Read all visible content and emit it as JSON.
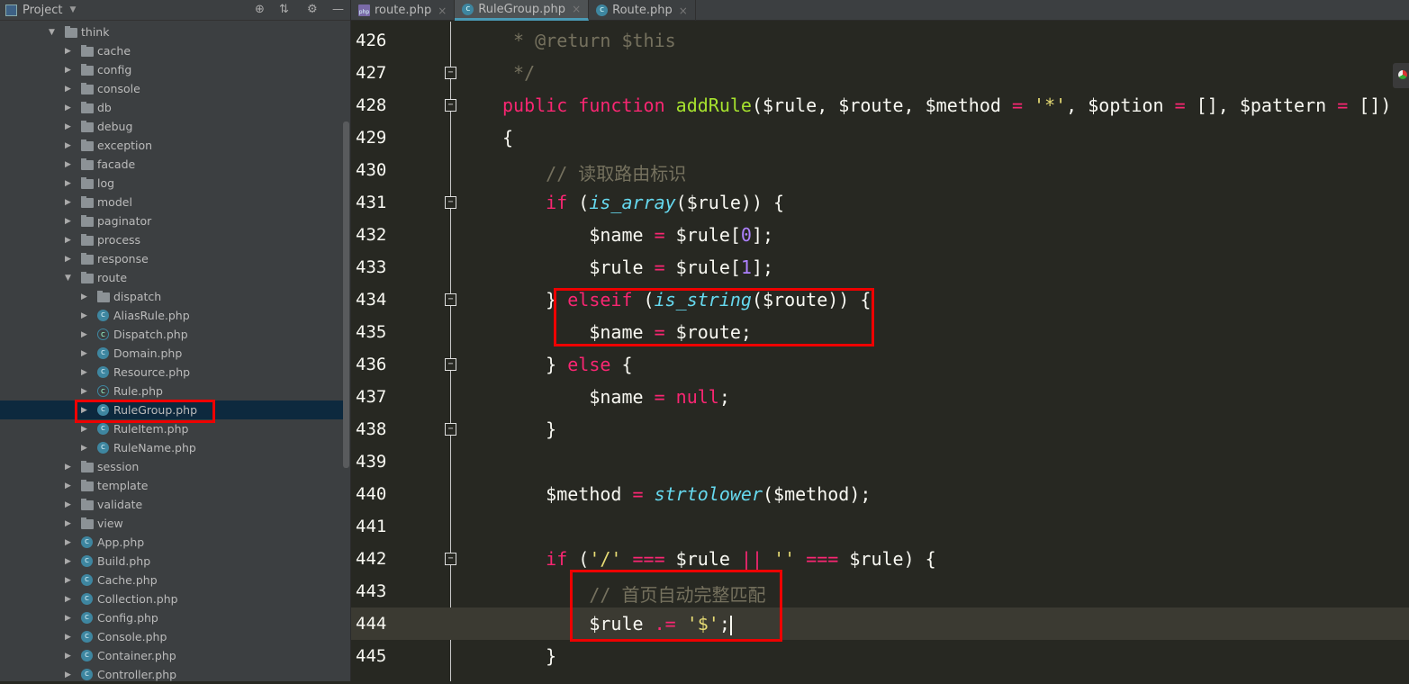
{
  "sidebar": {
    "title": "Project",
    "tree": [
      {
        "label": "think",
        "depth": 0,
        "type": "folder",
        "open": true
      },
      {
        "label": "cache",
        "depth": 1,
        "type": "folder"
      },
      {
        "label": "config",
        "depth": 1,
        "type": "folder"
      },
      {
        "label": "console",
        "depth": 1,
        "type": "folder"
      },
      {
        "label": "db",
        "depth": 1,
        "type": "folder"
      },
      {
        "label": "debug",
        "depth": 1,
        "type": "folder"
      },
      {
        "label": "exception",
        "depth": 1,
        "type": "folder"
      },
      {
        "label": "facade",
        "depth": 1,
        "type": "folder"
      },
      {
        "label": "log",
        "depth": 1,
        "type": "folder"
      },
      {
        "label": "model",
        "depth": 1,
        "type": "folder"
      },
      {
        "label": "paginator",
        "depth": 1,
        "type": "folder"
      },
      {
        "label": "process",
        "depth": 1,
        "type": "folder"
      },
      {
        "label": "response",
        "depth": 1,
        "type": "folder"
      },
      {
        "label": "route",
        "depth": 1,
        "type": "folder",
        "open": true
      },
      {
        "label": "dispatch",
        "depth": 2,
        "type": "folder"
      },
      {
        "label": "AliasRule.php",
        "depth": 2,
        "type": "class"
      },
      {
        "label": "Dispatch.php",
        "depth": 2,
        "type": "abstract"
      },
      {
        "label": "Domain.php",
        "depth": 2,
        "type": "class"
      },
      {
        "label": "Resource.php",
        "depth": 2,
        "type": "class"
      },
      {
        "label": "Rule.php",
        "depth": 2,
        "type": "abstract"
      },
      {
        "label": "RuleGroup.php",
        "depth": 2,
        "type": "class",
        "selected": true
      },
      {
        "label": "RuleItem.php",
        "depth": 2,
        "type": "class"
      },
      {
        "label": "RuleName.php",
        "depth": 2,
        "type": "class"
      },
      {
        "label": "session",
        "depth": 1,
        "type": "folder"
      },
      {
        "label": "template",
        "depth": 1,
        "type": "folder"
      },
      {
        "label": "validate",
        "depth": 1,
        "type": "folder"
      },
      {
        "label": "view",
        "depth": 1,
        "type": "folder"
      },
      {
        "label": "App.php",
        "depth": 1,
        "type": "class"
      },
      {
        "label": "Build.php",
        "depth": 1,
        "type": "class"
      },
      {
        "label": "Cache.php",
        "depth": 1,
        "type": "class"
      },
      {
        "label": "Collection.php",
        "depth": 1,
        "type": "class"
      },
      {
        "label": "Config.php",
        "depth": 1,
        "type": "class"
      },
      {
        "label": "Console.php",
        "depth": 1,
        "type": "class"
      },
      {
        "label": "Container.php",
        "depth": 1,
        "type": "class"
      },
      {
        "label": "Controller.php",
        "depth": 1,
        "type": "class"
      }
    ]
  },
  "tabs": [
    {
      "label": "route.php",
      "icon": "php-file-icon"
    },
    {
      "label": "RuleGroup.php",
      "icon": "class-icon",
      "active": true
    },
    {
      "label": "Route.php",
      "icon": "class-icon"
    }
  ],
  "editor": {
    "current_line": 444,
    "lines": [
      {
        "num": "426",
        "tokens": [
          [
            "c",
            " * @return $this"
          ]
        ]
      },
      {
        "num": "427",
        "tokens": [
          [
            "c",
            " */"
          ]
        ]
      },
      {
        "num": "428",
        "tokens": [
          [
            "k",
            "public function "
          ],
          [
            "f",
            "addRule"
          ],
          [
            "v",
            "($rule, $route, $method "
          ],
          [
            "k",
            "="
          ],
          [
            "v",
            " "
          ],
          [
            "s",
            "'*'"
          ],
          [
            "v",
            ", $option "
          ],
          [
            "k",
            "="
          ],
          [
            "v",
            " [], $pattern "
          ],
          [
            "k",
            "="
          ],
          [
            "v",
            " [])"
          ]
        ]
      },
      {
        "num": "429",
        "tokens": [
          [
            "v",
            "{"
          ]
        ]
      },
      {
        "num": "430",
        "tokens": [
          [
            "c",
            "    // 读取路由标识"
          ]
        ]
      },
      {
        "num": "431",
        "tokens": [
          [
            "k",
            "    if"
          ],
          [
            "v",
            " ("
          ],
          [
            "b",
            "is_array"
          ],
          [
            "v",
            "($rule)) {"
          ]
        ]
      },
      {
        "num": "432",
        "tokens": [
          [
            "v",
            "        $name "
          ],
          [
            "k",
            "="
          ],
          [
            "v",
            " $rule["
          ],
          [
            "n",
            "0"
          ],
          [
            "v",
            "];"
          ]
        ]
      },
      {
        "num": "433",
        "tokens": [
          [
            "v",
            "        $rule "
          ],
          [
            "k",
            "="
          ],
          [
            "v",
            " $rule["
          ],
          [
            "n",
            "1"
          ],
          [
            "v",
            "];"
          ]
        ]
      },
      {
        "num": "434",
        "tokens": [
          [
            "v",
            "    } "
          ],
          [
            "k",
            "elseif"
          ],
          [
            "v",
            " ("
          ],
          [
            "b",
            "is_string"
          ],
          [
            "v",
            "($route)) {"
          ]
        ]
      },
      {
        "num": "435",
        "tokens": [
          [
            "v",
            "        $name "
          ],
          [
            "k",
            "="
          ],
          [
            "v",
            " $route;"
          ]
        ]
      },
      {
        "num": "436",
        "tokens": [
          [
            "v",
            "    } "
          ],
          [
            "k",
            "else"
          ],
          [
            "v",
            " {"
          ]
        ]
      },
      {
        "num": "437",
        "tokens": [
          [
            "v",
            "        $name "
          ],
          [
            "k",
            "="
          ],
          [
            "v",
            " "
          ],
          [
            "k",
            "null"
          ],
          [
            "v",
            ";"
          ]
        ]
      },
      {
        "num": "438",
        "tokens": [
          [
            "v",
            "    }"
          ]
        ]
      },
      {
        "num": "439",
        "tokens": []
      },
      {
        "num": "440",
        "tokens": [
          [
            "v",
            "    $method "
          ],
          [
            "k",
            "="
          ],
          [
            "v",
            " "
          ],
          [
            "b",
            "strtolower"
          ],
          [
            "v",
            "($method);"
          ]
        ]
      },
      {
        "num": "441",
        "tokens": []
      },
      {
        "num": "442",
        "tokens": [
          [
            "k",
            "    if"
          ],
          [
            "v",
            " ("
          ],
          [
            "s",
            "'/'"
          ],
          [
            "v",
            " "
          ],
          [
            "k",
            "==="
          ],
          [
            "v",
            " $rule "
          ],
          [
            "k",
            "||"
          ],
          [
            "v",
            " "
          ],
          [
            "s",
            "''"
          ],
          [
            "v",
            " "
          ],
          [
            "k",
            "==="
          ],
          [
            "v",
            " $rule) {"
          ]
        ]
      },
      {
        "num": "443",
        "tokens": [
          [
            "c",
            "        // 首页自动完整匹配"
          ]
        ]
      },
      {
        "num": "444",
        "tokens": [
          [
            "v",
            "        $rule "
          ],
          [
            "k",
            ".="
          ],
          [
            "v",
            " "
          ],
          [
            "s",
            "'$'"
          ],
          [
            "v",
            ";"
          ]
        ]
      },
      {
        "num": "445",
        "tokens": [
          [
            "v",
            "    }"
          ]
        ]
      }
    ]
  },
  "colors": {
    "keyword": "#f92672",
    "function": "#a6e22e",
    "builtin": "#66d9ef",
    "number": "#ae81ff",
    "string": "#e6db74",
    "comment": "#75715e",
    "highlight_box": "#ee0000"
  }
}
